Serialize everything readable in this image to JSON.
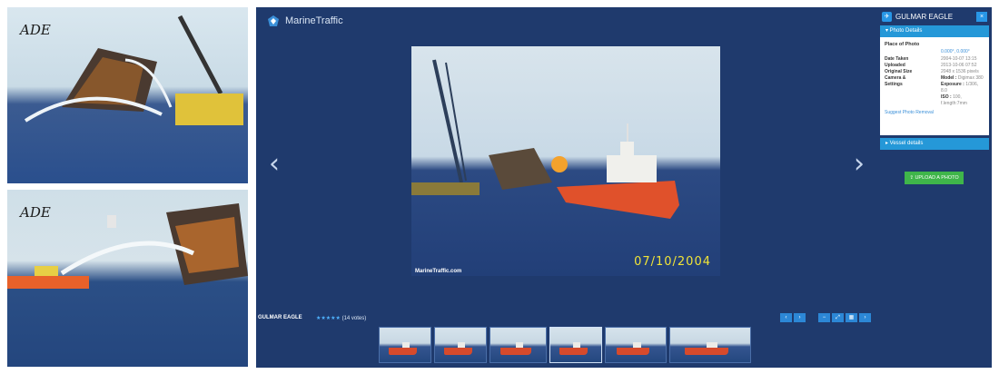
{
  "left_photos": [
    {
      "watermark": "ADE"
    },
    {
      "watermark": "ADE"
    }
  ],
  "viewer": {
    "brand": "MarineTraffic",
    "prev_icon": "‹",
    "next_icon": "›",
    "photo": {
      "date_stamp": "07/10/2004",
      "watermark": "MarineTraffic.com"
    },
    "vessel_name": "GULMAR EAGLE",
    "stars": "★★★★★",
    "votes": "(14 votes)",
    "controls": {
      "prev": "‹",
      "next": "›",
      "zoom_out": "−",
      "fit": "⤢",
      "grid": "▦",
      "forward": "›"
    },
    "thumbnails_count": 6
  },
  "panel": {
    "title": "GULMAR EAGLE",
    "close": "×",
    "photo_details_label": "▾ Photo Details",
    "place_label": "Place of Photo",
    "coordinates": "0.000°, 0.000°",
    "rows": [
      {
        "key": "Date Taken",
        "value": "2004-10-07 13:15"
      },
      {
        "key": "Uploaded",
        "value": "2013-10-06 07:52"
      },
      {
        "key": "Original Size",
        "value": "2048 x 1536 pixels"
      }
    ],
    "camera": {
      "key": "Camera &",
      "key2": "Settings",
      "model_label": "Model :",
      "model": "Digimax 380",
      "exposure_label": "Exposure :",
      "exposure": "1/306, 8.0",
      "iso_label": "ISO :",
      "iso": "100, f.length:7mm"
    },
    "suggest": "Suggest Photo Removal",
    "vessel_details_label": "▸ Vessel details",
    "upload_label": "⇪ UPLOAD A PHOTO"
  },
  "colors": {
    "viewer_bg": "#1f3a6d",
    "accent": "#2598d8",
    "upload": "#3fb54a",
    "date_stamp": "#f1e437"
  }
}
